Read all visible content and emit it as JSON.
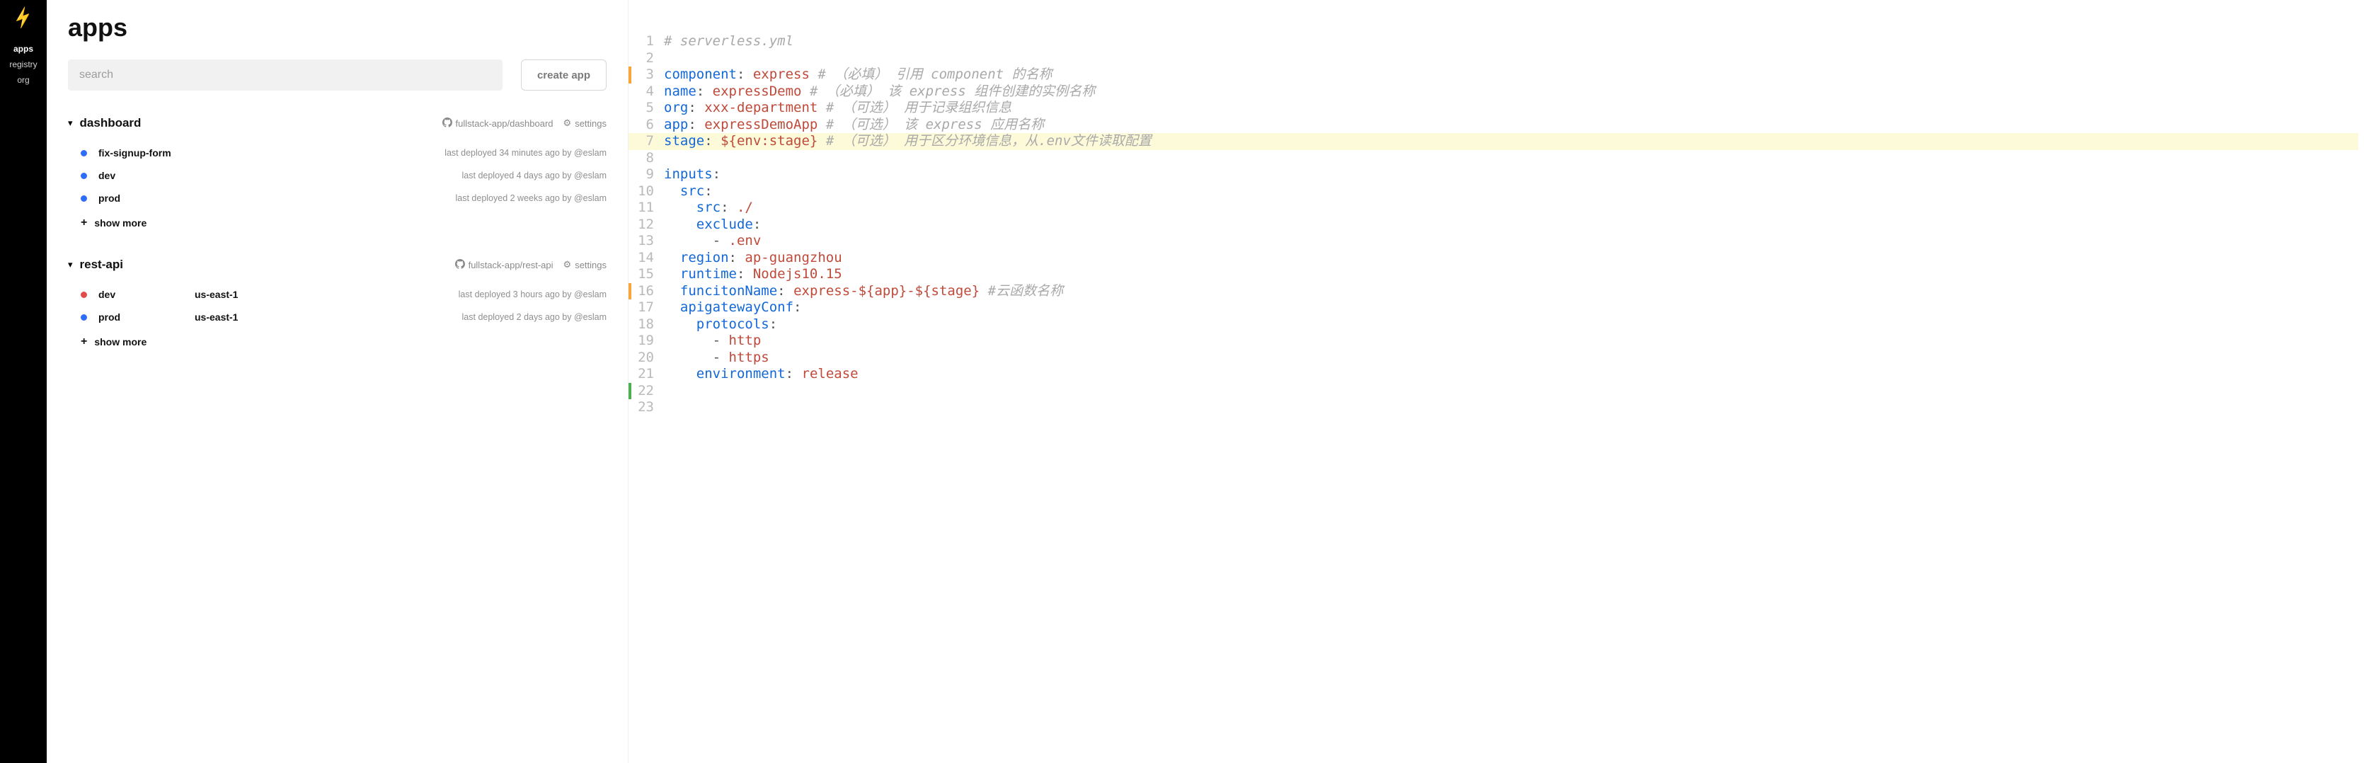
{
  "sidebar": {
    "items": [
      {
        "id": "apps",
        "label": "apps",
        "active": true
      },
      {
        "id": "registry",
        "label": "registry",
        "active": false
      },
      {
        "id": "org",
        "label": "org",
        "active": false
      }
    ]
  },
  "apps_panel": {
    "title": "apps",
    "search_placeholder": "search",
    "create_button": "create app",
    "settings_label": "settings",
    "show_more_label": "show more",
    "apps": [
      {
        "name": "dashboard",
        "repo": "fullstack-app/dashboard",
        "instances": [
          {
            "dot": "blue",
            "name": "fix-signup-form",
            "region": "",
            "meta": "last deployed 34 minutes ago by @eslam"
          },
          {
            "dot": "blue",
            "name": "dev",
            "region": "",
            "meta": "last deployed 4 days ago by @eslam"
          },
          {
            "dot": "blue",
            "name": "prod",
            "region": "",
            "meta": "last deployed 2 weeks ago by @eslam"
          }
        ]
      },
      {
        "name": "rest-api",
        "repo": "fullstack-app/rest-api",
        "instances": [
          {
            "dot": "red",
            "name": "dev",
            "region": "us-east-1",
            "meta": "last deployed 3 hours ago by @eslam"
          },
          {
            "dot": "blue",
            "name": "prod",
            "region": "us-east-1",
            "meta": "last deployed 2 days ago by @eslam"
          }
        ]
      }
    ]
  },
  "code": {
    "lines": [
      {
        "n": 1,
        "mark": "",
        "tokens": [
          [
            "c-comment",
            "# serverless.yml"
          ]
        ]
      },
      {
        "n": 2,
        "mark": "",
        "tokens": [
          [
            "",
            ""
          ]
        ]
      },
      {
        "n": 3,
        "mark": "bar-orange",
        "tokens": [
          [
            "c-key",
            "component"
          ],
          [
            "c-punc",
            ": "
          ],
          [
            "c-str",
            "express"
          ],
          [
            "",
            " "
          ],
          [
            "c-comment",
            "# （必填） 引用 component 的名称"
          ]
        ]
      },
      {
        "n": 4,
        "mark": "",
        "tokens": [
          [
            "c-key",
            "name"
          ],
          [
            "c-punc",
            ": "
          ],
          [
            "c-str",
            "expressDemo"
          ],
          [
            "",
            " "
          ],
          [
            "c-comment",
            "# （必填） 该 express 组件创建的实例名称"
          ]
        ]
      },
      {
        "n": 5,
        "mark": "",
        "tokens": [
          [
            "c-key",
            "org"
          ],
          [
            "c-punc",
            ": "
          ],
          [
            "c-str",
            "xxx-department"
          ],
          [
            "",
            " "
          ],
          [
            "c-comment",
            "# （可选） 用于记录组织信息"
          ]
        ]
      },
      {
        "n": 6,
        "mark": "",
        "tokens": [
          [
            "c-key",
            "app"
          ],
          [
            "c-punc",
            ": "
          ],
          [
            "c-str",
            "expressDemoApp"
          ],
          [
            "",
            " "
          ],
          [
            "c-comment",
            "# （可选） 该 express 应用名称"
          ]
        ]
      },
      {
        "n": 7,
        "mark": "sel",
        "tokens": [
          [
            "c-key",
            "stage"
          ],
          [
            "c-punc",
            ": "
          ],
          [
            "c-var",
            "${env:stage}"
          ],
          [
            "",
            " "
          ],
          [
            "c-comment",
            "# （可选） 用于区分环境信息，从.env文件读取配置"
          ]
        ]
      },
      {
        "n": 8,
        "mark": "",
        "tokens": [
          [
            "",
            ""
          ]
        ]
      },
      {
        "n": 9,
        "mark": "",
        "tokens": [
          [
            "c-key",
            "inputs"
          ],
          [
            "c-punc",
            ":"
          ]
        ]
      },
      {
        "n": 10,
        "mark": "",
        "tokens": [
          [
            "",
            "  "
          ],
          [
            "c-key",
            "src"
          ],
          [
            "c-punc",
            ":"
          ]
        ]
      },
      {
        "n": 11,
        "mark": "",
        "tokens": [
          [
            "",
            "    "
          ],
          [
            "c-key",
            "src"
          ],
          [
            "c-punc",
            ": "
          ],
          [
            "c-str",
            "./"
          ]
        ]
      },
      {
        "n": 12,
        "mark": "",
        "tokens": [
          [
            "",
            "    "
          ],
          [
            "c-key",
            "exclude"
          ],
          [
            "c-punc",
            ":"
          ]
        ]
      },
      {
        "n": 13,
        "mark": "",
        "tokens": [
          [
            "",
            "      "
          ],
          [
            "c-punc",
            "- "
          ],
          [
            "c-str",
            ".env"
          ]
        ]
      },
      {
        "n": 14,
        "mark": "",
        "tokens": [
          [
            "",
            "  "
          ],
          [
            "c-key",
            "region"
          ],
          [
            "c-punc",
            ": "
          ],
          [
            "c-str",
            "ap-guangzhou"
          ]
        ]
      },
      {
        "n": 15,
        "mark": "",
        "tokens": [
          [
            "",
            "  "
          ],
          [
            "c-key",
            "runtime"
          ],
          [
            "c-punc",
            ": "
          ],
          [
            "c-str",
            "Nodejs10.15"
          ]
        ]
      },
      {
        "n": 16,
        "mark": "bar-orange",
        "tokens": [
          [
            "",
            "  "
          ],
          [
            "c-key",
            "funcitonName"
          ],
          [
            "c-punc",
            ": "
          ],
          [
            "c-var",
            "express-${app}-${stage}"
          ],
          [
            "",
            " "
          ],
          [
            "c-comment",
            "#云函数名称"
          ]
        ]
      },
      {
        "n": 17,
        "mark": "",
        "tokens": [
          [
            "",
            "  "
          ],
          [
            "c-key",
            "apigatewayConf"
          ],
          [
            "c-punc",
            ":"
          ]
        ]
      },
      {
        "n": 18,
        "mark": "",
        "tokens": [
          [
            "",
            "    "
          ],
          [
            "c-key",
            "protocols"
          ],
          [
            "c-punc",
            ":"
          ]
        ]
      },
      {
        "n": 19,
        "mark": "",
        "tokens": [
          [
            "",
            "      "
          ],
          [
            "c-punc",
            "- "
          ],
          [
            "c-str",
            "http"
          ]
        ]
      },
      {
        "n": 20,
        "mark": "",
        "tokens": [
          [
            "",
            "      "
          ],
          [
            "c-punc",
            "- "
          ],
          [
            "c-str",
            "https"
          ]
        ]
      },
      {
        "n": 21,
        "mark": "",
        "tokens": [
          [
            "",
            "    "
          ],
          [
            "c-key",
            "environment"
          ],
          [
            "c-punc",
            ": "
          ],
          [
            "c-str",
            "release"
          ]
        ]
      },
      {
        "n": 22,
        "mark": "bar-green",
        "tokens": [
          [
            "",
            ""
          ]
        ]
      },
      {
        "n": 23,
        "mark": "",
        "tokens": [
          [
            "",
            ""
          ]
        ]
      }
    ]
  }
}
